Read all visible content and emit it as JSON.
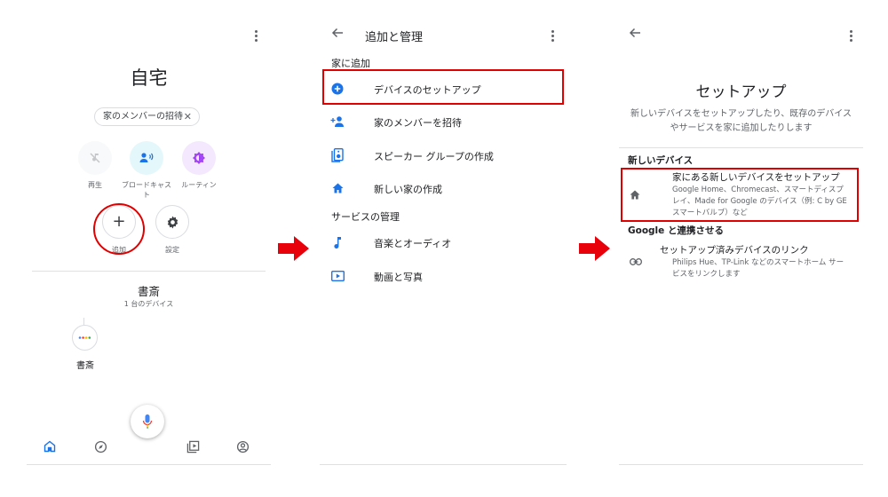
{
  "colors": {
    "blue": "#1a73e8",
    "red": "#e00000",
    "purple": "#a142f4",
    "teal_bg": "#e4f7fb",
    "purple_bg": "#f3e8fd",
    "gray_icon": "#5f6368"
  },
  "screen1": {
    "title": "自宅",
    "chip_label": "家のメンバーの招待",
    "chip_close": "✕",
    "actions": [
      {
        "label": "再生",
        "icon": "no-music-icon"
      },
      {
        "label": "ブロードキャスト",
        "icon": "broadcast-icon"
      },
      {
        "label": "ルーティン",
        "icon": "routine-icon"
      },
      {
        "label": "追加",
        "icon": "plus-icon"
      },
      {
        "label": "設定",
        "icon": "gear-icon"
      }
    ],
    "add_symbol": "+",
    "room_name": "書斎",
    "room_device_count": "1 台のデバイス",
    "device_label": "書斎",
    "nav": [
      "home-icon",
      "discover-icon",
      "media-icon",
      "account-icon"
    ]
  },
  "screen2": {
    "title": "追加と管理",
    "section_add": "家に追加",
    "items_add": [
      "デバイスのセットアップ",
      "家のメンバーを招待",
      "スピーカー グループの作成",
      "新しい家の作成"
    ],
    "section_services": "サービスの管理",
    "items_services": [
      "音楽とオーディオ",
      "動画と写真"
    ]
  },
  "screen3": {
    "title": "セットアップ",
    "description_line1": "新しいデバイスをセットアップしたり、既存のデバイス",
    "description_line2": "やサービスを家に追加したりします",
    "section_new": "新しいデバイス",
    "new_item_title": "家にある新しいデバイスをセットアップ",
    "new_item_desc_l1": "Google Home、Chromecast、スマートディスプ",
    "new_item_desc_l2": "レイ、Made for Google のデバイス（例: C by GE",
    "new_item_desc_l3": "スマートバルブ）など",
    "section_google": "Google と連携させる",
    "link_item_title": "セットアップ済みデバイスのリンク",
    "link_item_desc_l1": "Philips Hue、TP-Link などのスマートホーム サー",
    "link_item_desc_l2": "ビスをリンクします"
  }
}
